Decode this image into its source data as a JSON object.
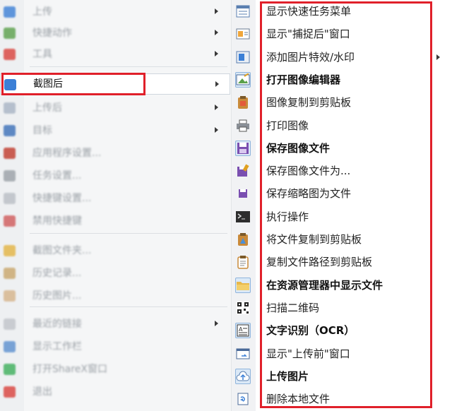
{
  "colors": {
    "highlight_border": "#e0202a",
    "icon_box_fill": "#dbe9f7",
    "icon_box_border": "#8fb4dc"
  },
  "left_menu": {
    "items": [
      {
        "label": "上传",
        "icon": "upload-icon",
        "icon_color": "#3b7fd6",
        "has_submenu": true
      },
      {
        "label": "快捷动作",
        "icon": "actions-icon",
        "icon_color": "#5aa04a",
        "has_submenu": true
      },
      {
        "label": "工具",
        "icon": "toolbox-icon",
        "icon_color": "#d9413b",
        "has_submenu": true
      },
      {
        "label": "截图后",
        "icon": "after-capture-icon",
        "icon_color": "#3b7fd6",
        "has_submenu": true,
        "active": true
      },
      {
        "label": "上传后",
        "icon": "cloud-icon",
        "icon_color": "#a8b4c4",
        "has_submenu": true
      },
      {
        "label": "目标",
        "icon": "destination-icon",
        "icon_color": "#3a6fb8",
        "has_submenu": true
      },
      {
        "label": "应用程序设置...",
        "icon": "app-settings-icon",
        "icon_color": "#c0392b",
        "has_submenu": false
      },
      {
        "label": "任务设置...",
        "icon": "task-settings-icon",
        "icon_color": "#9aa0a6",
        "has_submenu": false
      },
      {
        "label": "快捷键设置...",
        "icon": "hotkey-settings-icon",
        "icon_color": "#b9bec5",
        "has_submenu": false
      },
      {
        "label": "禁用快捷键",
        "icon": "disable-hotkeys-icon",
        "icon_color": "#d05a5a",
        "has_submenu": false
      },
      {
        "label": "截图文件夹...",
        "icon": "folder-icon",
        "icon_color": "#e3b341",
        "has_submenu": false
      },
      {
        "label": "历史记录...",
        "icon": "history-icon",
        "icon_color": "#c9a66b",
        "has_submenu": false
      },
      {
        "label": "历史图片...",
        "icon": "image-history-icon",
        "icon_color": "#d6b38a",
        "has_submenu": false
      },
      {
        "label": "最近的链接",
        "icon": "recent-links-icon",
        "icon_color": "#c0c4c9",
        "has_submenu": true
      },
      {
        "label": "显示工作栏",
        "icon": "workbar-icon",
        "icon_color": "#5b8fcf",
        "has_submenu": false
      },
      {
        "label": "打开ShareX窗口",
        "icon": "sharex-icon",
        "icon_color": "#3cae5a",
        "has_submenu": false
      },
      {
        "label": "退出",
        "icon": "exit-icon",
        "icon_color": "#d9413b",
        "has_submenu": false
      }
    ]
  },
  "right_menu": {
    "items": [
      {
        "label": "显示快速任务菜单",
        "icon": "quick-task-menu-icon",
        "bold": false,
        "boxed": false,
        "has_submenu": false
      },
      {
        "label": "显示\"捕捉后\"窗口",
        "icon": "after-capture-window-icon",
        "bold": false,
        "boxed": false,
        "has_submenu": false
      },
      {
        "label": "添加图片特效/水印",
        "icon": "image-effects-icon",
        "bold": false,
        "boxed": false,
        "has_submenu": true
      },
      {
        "label": "打开图像编辑器",
        "icon": "image-editor-icon",
        "bold": true,
        "boxed": true,
        "has_submenu": false
      },
      {
        "label": "图像复制到剪贴板",
        "icon": "copy-image-icon",
        "bold": false,
        "boxed": false,
        "has_submenu": false
      },
      {
        "label": "打印图像",
        "icon": "printer-icon",
        "bold": false,
        "boxed": false,
        "has_submenu": false
      },
      {
        "label": "保存图像文件",
        "icon": "save-icon",
        "bold": true,
        "boxed": true,
        "has_submenu": false
      },
      {
        "label": "保存图像文件为...",
        "icon": "save-as-icon",
        "bold": false,
        "boxed": false,
        "has_submenu": false
      },
      {
        "label": "保存缩略图为文件",
        "icon": "save-thumbnail-icon",
        "bold": false,
        "boxed": false,
        "has_submenu": false
      },
      {
        "label": "执行操作",
        "icon": "terminal-icon",
        "bold": false,
        "boxed": false,
        "has_submenu": false
      },
      {
        "label": "将文件复制到剪贴板",
        "icon": "copy-file-icon",
        "bold": false,
        "boxed": false,
        "has_submenu": false
      },
      {
        "label": "复制文件路径到剪贴板",
        "icon": "copy-path-icon",
        "bold": false,
        "boxed": false,
        "has_submenu": false
      },
      {
        "label": "在资源管理器中显示文件",
        "icon": "explorer-folder-icon",
        "bold": true,
        "boxed": true,
        "has_submenu": false
      },
      {
        "label": "扫描二维码",
        "icon": "qr-code-icon",
        "bold": false,
        "boxed": false,
        "has_submenu": false
      },
      {
        "label": "文字识别（OCR）",
        "icon": "ocr-icon",
        "bold": true,
        "boxed": true,
        "has_submenu": false
      },
      {
        "label": "显示\"上传前\"窗口",
        "icon": "before-upload-window-icon",
        "bold": false,
        "boxed": false,
        "has_submenu": false
      },
      {
        "label": "上传图片",
        "icon": "upload-cloud-icon",
        "bold": true,
        "boxed": true,
        "has_submenu": false
      },
      {
        "label": "删除本地文件",
        "icon": "delete-file-icon",
        "bold": false,
        "boxed": false,
        "has_submenu": false
      }
    ]
  }
}
